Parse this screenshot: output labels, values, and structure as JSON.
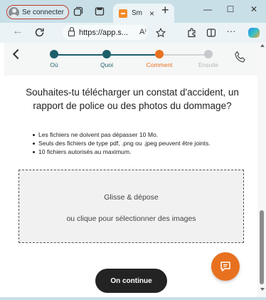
{
  "browser": {
    "profile_label": "Se connecter",
    "tab_title": "Sm",
    "tab_close": "×",
    "new_tab": "+",
    "window_minimize": "—",
    "window_maximize": "☐",
    "window_close": "✕",
    "url": "https://app.s...",
    "read_aloud_label": "A⁾",
    "more_label": "···"
  },
  "stepper": {
    "steps": [
      {
        "label": "Où",
        "status": "done",
        "color": "#1d5e6b"
      },
      {
        "label": "Quoi",
        "status": "done",
        "color": "#1d5e6b"
      },
      {
        "label": "Comment",
        "status": "current",
        "color": "#e8711f"
      },
      {
        "label": "Ensuite",
        "status": "upcoming",
        "color": "#c7c9cc"
      }
    ]
  },
  "main": {
    "question": "Souhaites-tu télécharger un constat d'accident, un rapport de police ou des photos du dommage?",
    "rules": [
      "Les fichiers ne doivent pas dépasser 10 Mo.",
      "Seuls des fichiers de type pdf, .png ou .jpeg peuvent être joints.",
      "10 fichiers autorisés au maximum."
    ],
    "dropzone": {
      "line1": "Glisse & dépose",
      "line2": "ou clique pour sélectionner des images"
    },
    "continue_label": "On continue"
  },
  "colors": {
    "accent": "#e8711f",
    "done": "#1d5e6b",
    "button": "#232323"
  }
}
